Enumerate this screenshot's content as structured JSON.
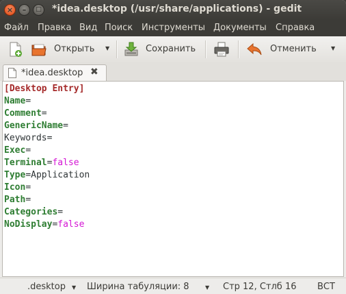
{
  "window": {
    "title": "*idea.desktop (/usr/share/applications) - gedit"
  },
  "menubar": {
    "items": [
      "Файл",
      "Правка",
      "Вид",
      "Поиск",
      "Инструменты",
      "Документы",
      "Справка"
    ]
  },
  "toolbar": {
    "open_label": "Открыть",
    "save_label": "Сохранить",
    "undo_label": "Отменить"
  },
  "tab": {
    "label": "*idea.desktop"
  },
  "editor": {
    "lines": [
      {
        "key": "[Desktop Entry]",
        "sep": "",
        "value": "",
        "key_style": "section",
        "value_style": "plain"
      },
      {
        "key": "Name",
        "sep": "=",
        "value": "",
        "key_style": "key",
        "value_style": "plain"
      },
      {
        "key": "Comment",
        "sep": "=",
        "value": "",
        "key_style": "key",
        "value_style": "plain"
      },
      {
        "key": "GenericName",
        "sep": "=",
        "value": "",
        "key_style": "key",
        "value_style": "plain"
      },
      {
        "key": "Keywords",
        "sep": "=",
        "value": "",
        "key_style": "plain",
        "value_style": "plain"
      },
      {
        "key": "Exec",
        "sep": "=",
        "value": "",
        "key_style": "key",
        "value_style": "plain"
      },
      {
        "key": "Terminal",
        "sep": "=",
        "value": "false",
        "key_style": "key",
        "value_style": "bool"
      },
      {
        "key": "Type",
        "sep": "=",
        "value": "Application",
        "key_style": "key",
        "value_style": "plain"
      },
      {
        "key": "Icon",
        "sep": "=",
        "value": "",
        "key_style": "key",
        "value_style": "plain"
      },
      {
        "key": "Path",
        "sep": "=",
        "value": "",
        "key_style": "key",
        "value_style": "plain"
      },
      {
        "key": "Categories",
        "sep": "=",
        "value": "",
        "key_style": "key",
        "value_style": "plain"
      },
      {
        "key": "NoDisplay",
        "sep": "=",
        "value": "false",
        "key_style": "key",
        "value_style": "bool"
      }
    ]
  },
  "statusbar": {
    "language": ".desktop",
    "tab_width": "Ширина табуляции:  8",
    "position": "Стр 12, Стлб 16",
    "mode": "ВСТ"
  },
  "colors": {
    "key": "#2e7d32",
    "section": "#a52a2a",
    "bool": "#d415d4",
    "titlebar": "#3c3b37",
    "close_button": "#df4a16"
  }
}
